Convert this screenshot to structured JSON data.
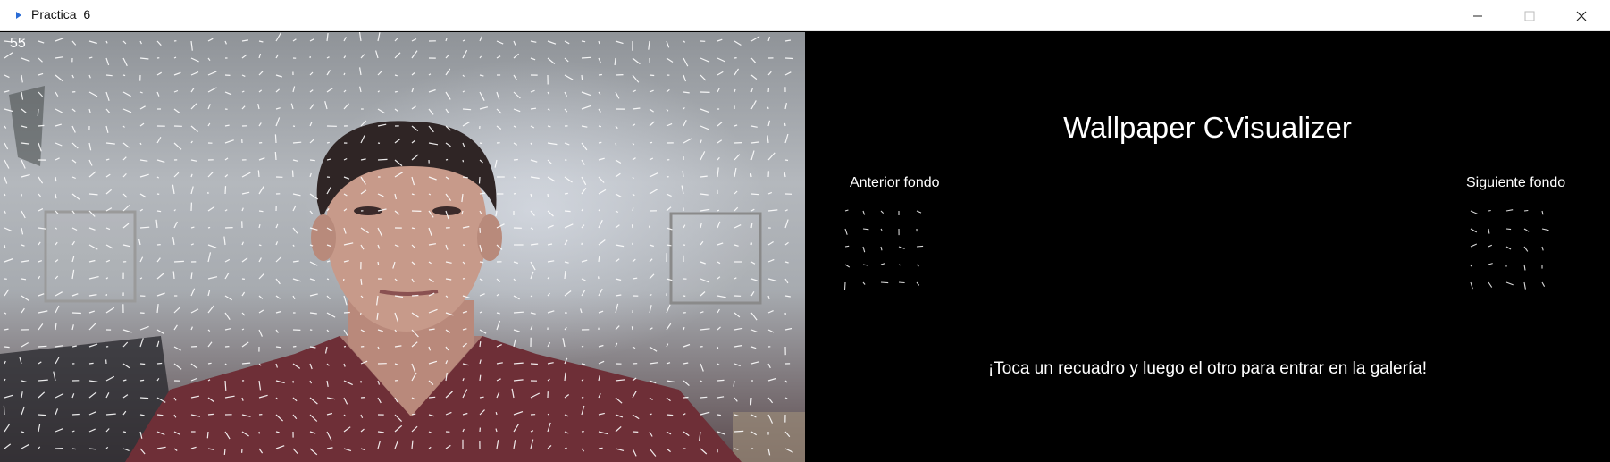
{
  "window": {
    "title": "Practica_6",
    "icons": [
      "app-icon",
      "minimize-icon",
      "maximize-icon",
      "close-icon"
    ]
  },
  "camera": {
    "fps": "55"
  },
  "panel": {
    "title": "Wallpaper CVisualizer",
    "prev_button_label": "Anterior fondo",
    "next_button_label": "Siguiente fondo",
    "hint": "¡Toca un recuadro y luego el otro para entrar en la galería!"
  },
  "colors": {
    "titlebar": "#ffffff",
    "background": "#000000",
    "text": "#ffffff",
    "target_box": "#9a9a9a"
  }
}
